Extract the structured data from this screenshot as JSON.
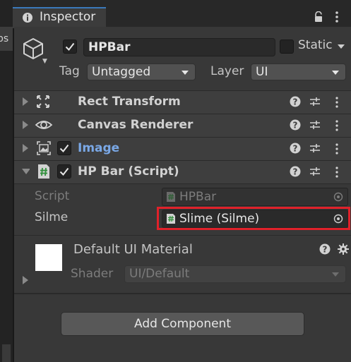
{
  "left_panel": {
    "tab_text": "bs"
  },
  "window": {
    "tab_title": "Inspector"
  },
  "gameobject": {
    "name": "HPBar",
    "active": true,
    "static_label": "Static",
    "static": false,
    "tag_label": "Tag",
    "tag_value": "Untagged",
    "layer_label": "Layer",
    "layer_value": "UI"
  },
  "components": [
    {
      "title": "Rect Transform",
      "icon": "rect-transform-icon",
      "highlight_title": false
    },
    {
      "title": "Canvas Renderer",
      "icon": "eye-icon",
      "highlight_title": false
    },
    {
      "title": "Image",
      "icon": "image-icon",
      "enabled": true,
      "highlight_title": true
    },
    {
      "title": "HP Bar (Script)",
      "icon": "script-icon",
      "enabled": true,
      "expanded": true
    }
  ],
  "script_fields": {
    "script_label": "Script",
    "script_value": "HPBar",
    "silme_label": "Silme",
    "silme_value": "Slime (Silme)"
  },
  "material": {
    "title": "Default UI Material",
    "shader_label": "Shader",
    "shader_value": "UI/Default"
  },
  "add_component_label": "Add Component",
  "colors": {
    "accent_tab": "#3a79bb",
    "image_title": "#7aa8e6",
    "highlight_box": "#e0212a",
    "panel_bg": "#383838"
  }
}
